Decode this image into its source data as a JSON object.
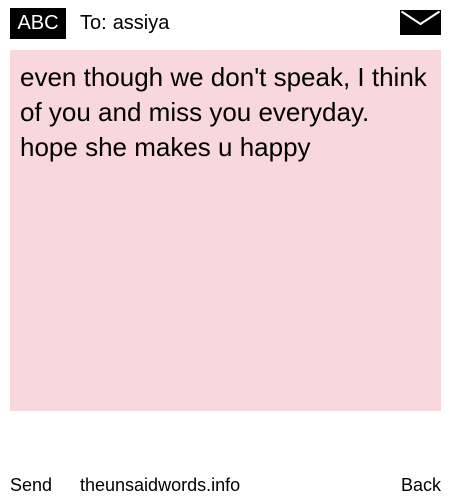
{
  "header": {
    "mode_label": "ABC",
    "to_label": "To:",
    "recipient": "assiya",
    "envelope_icon": "envelope-icon"
  },
  "message": {
    "body": "even though we don't speak, I think of you and miss you everyday. hope she makes u happy"
  },
  "footer": {
    "send_label": "Send",
    "site_label": "theunsaidwords.info",
    "back_label": "Back"
  },
  "colors": {
    "message_background": "#f8d8dc",
    "badge_background": "#000000",
    "badge_text": "#ffffff"
  }
}
